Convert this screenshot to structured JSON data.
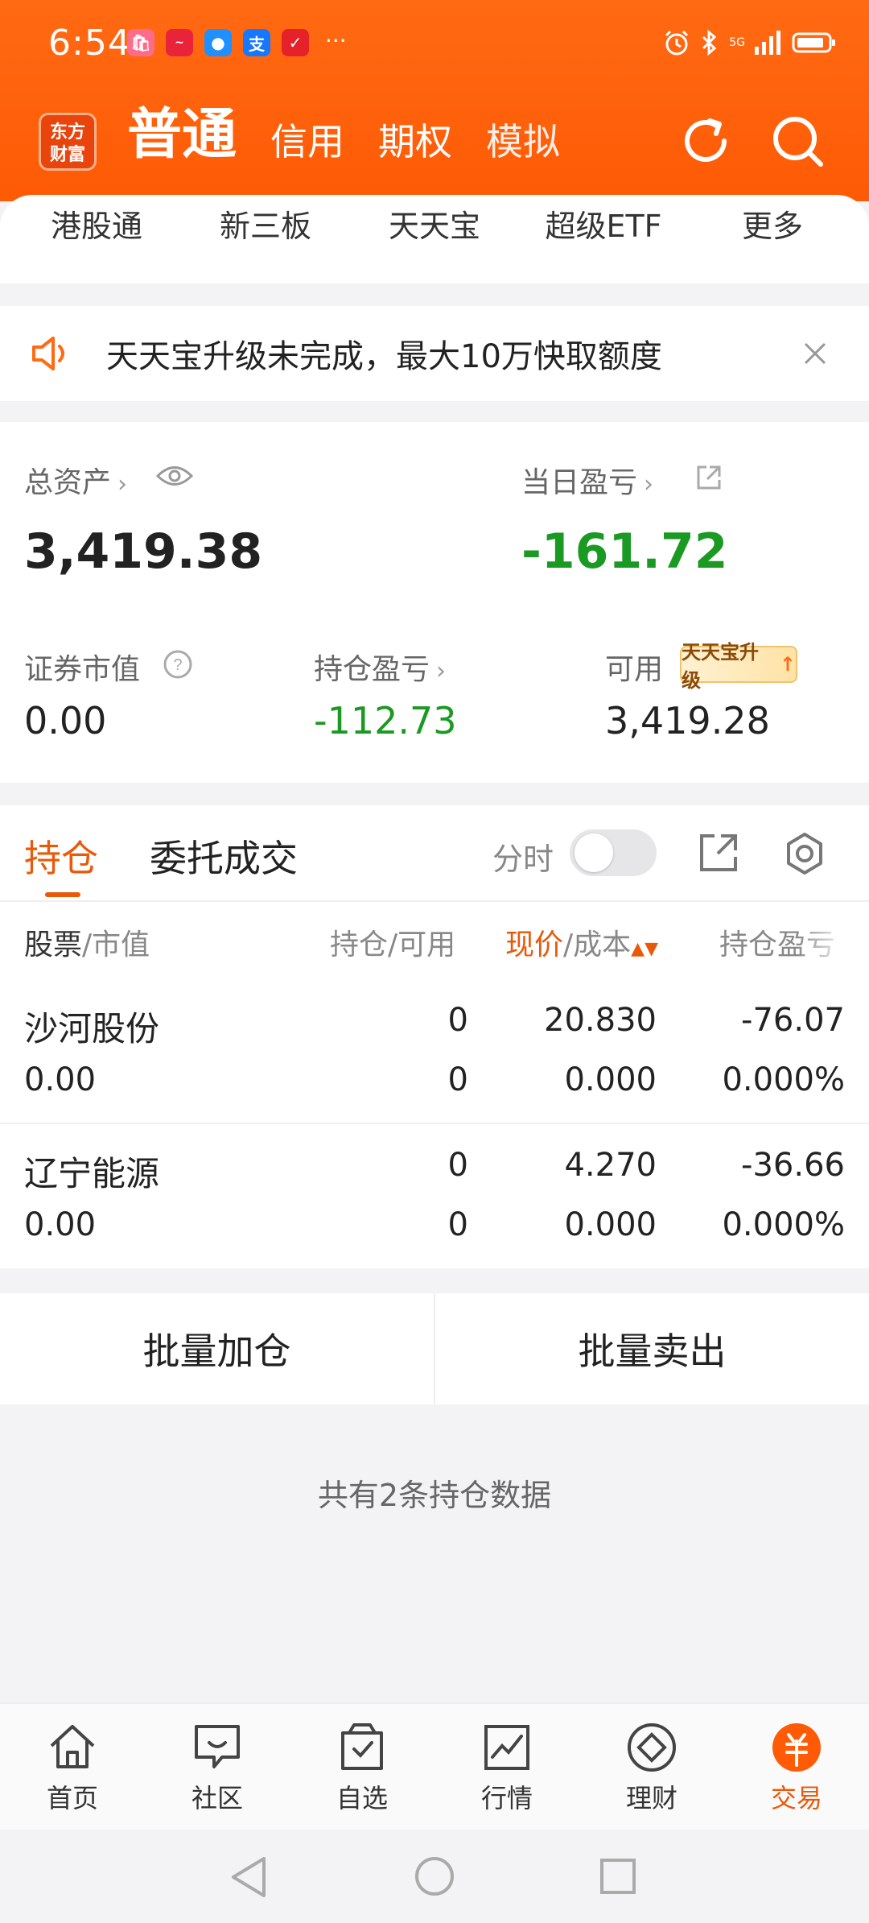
{
  "status": {
    "time": "6:54",
    "apps": [
      "shop",
      "stock",
      "message",
      "alipay",
      "news"
    ],
    "network": "5G",
    "more": "···"
  },
  "header": {
    "logo_line1": "东方",
    "logo_line2": "财富",
    "tabs": [
      "普通",
      "信用",
      "期权",
      "模拟"
    ]
  },
  "submenu": [
    "港股通",
    "新三板",
    "天天宝",
    "超级ETF",
    "更多"
  ],
  "notice": {
    "text": "天天宝升级未完成，最大10万快取额度"
  },
  "assets": {
    "total_label": "总资产",
    "total_value": "3,419.38",
    "daily_pl_label": "当日盈亏",
    "daily_pl_value": "-161.72",
    "market_value_label": "证券市值",
    "market_value": "0.00",
    "position_pl_label": "持仓盈亏",
    "position_pl_value": "-112.73",
    "available_label": "可用",
    "available_value": "3,419.28",
    "badge": "天天宝升级"
  },
  "holdings": {
    "tab_active": "持仓",
    "tab_other": "委托成交",
    "fenshi": "分时",
    "columns": {
      "stock": "股票",
      "mv": "/市值",
      "pos": "持仓/可用",
      "price": "现价",
      "cost": "/成本",
      "pl": "持仓盈亏"
    },
    "rows": [
      {
        "name": "沙河股份",
        "value": "0.00",
        "pos": "0",
        "avail": "0",
        "price": "20.830",
        "cost": "0.000",
        "pl": "-76.07",
        "pl_pct": "0.000%"
      },
      {
        "name": "辽宁能源",
        "value": "0.00",
        "pos": "0",
        "avail": "0",
        "price": "4.270",
        "cost": "0.000",
        "pl": "-36.66",
        "pl_pct": "0.000%"
      }
    ]
  },
  "bulk": {
    "add": "批量加仓",
    "sell": "批量卖出"
  },
  "count_text": "共有2条持仓数据",
  "nav": [
    "首页",
    "社区",
    "自选",
    "行情",
    "理财",
    "交易"
  ],
  "colors": {
    "brand": "#ff5a06",
    "accent": "#e85a0a",
    "loss_green": "#1a9a22"
  }
}
